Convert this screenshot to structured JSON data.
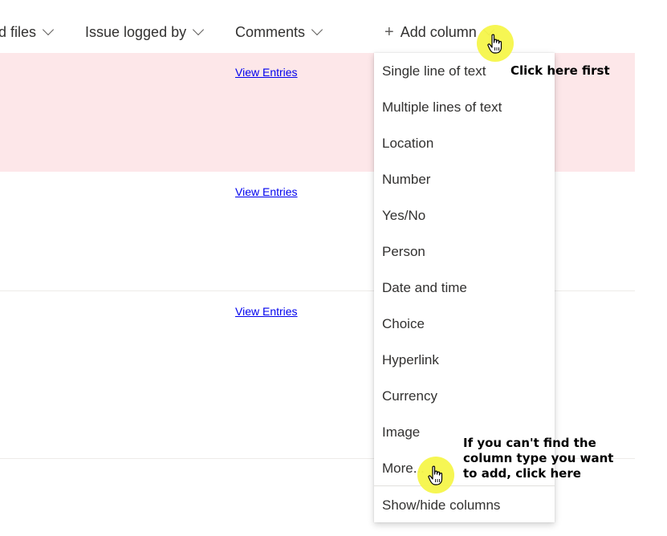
{
  "header": {
    "columns": [
      {
        "label": "d files"
      },
      {
        "label": "Issue logged by"
      },
      {
        "label": "Comments"
      }
    ],
    "add_column_label": "Add column"
  },
  "rows": [
    {
      "link": "View Entries",
      "highlighted": true
    },
    {
      "link": "View Entries",
      "highlighted": false
    },
    {
      "link": "View Entries",
      "highlighted": false
    }
  ],
  "menu": {
    "items": [
      "Single line of text",
      "Multiple lines of text",
      "Location",
      "Number",
      "Yes/No",
      "Person",
      "Date and time",
      "Choice",
      "Hyperlink",
      "Currency",
      "Image",
      "More..."
    ],
    "footer": "Show/hide columns"
  },
  "annotations": {
    "first": "Click here first",
    "second": "If you can't find the column type you want to add, click here"
  },
  "colors": {
    "highlight_row": "#fde7e9",
    "cursor_highlight": "#f6f54a",
    "link": "#0000ee"
  }
}
